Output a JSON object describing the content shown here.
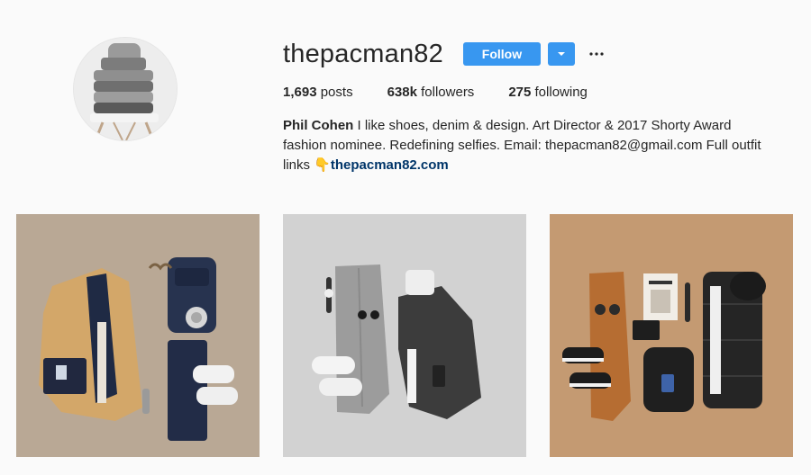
{
  "profile": {
    "username": "thepacman82",
    "follow_label": "Follow",
    "dropdown_icon": "chevron-down-icon",
    "more_icon": "more-options-icon",
    "stats": {
      "posts_count": "1,693",
      "posts_label": "posts",
      "followers_count": "638k",
      "followers_label": "followers",
      "following_count": "275",
      "following_label": "following"
    },
    "bio": {
      "name": "Phil Cohen",
      "text": " I like shoes, denim & design. Art Director & 2017 Shorty Award fashion nominee. Redefining selfies. Email: thepacman82@gmail.com Full outfit links ",
      "emoji": "👇",
      "link": "thepacman82.com"
    }
  },
  "posts": [
    {
      "background": "#b9a895",
      "subject": "camel coat outfit flat lay"
    },
    {
      "background": "#d2d2d2",
      "subject": "grey sweater outfit flat lay"
    },
    {
      "background": "#c49a72",
      "subject": "puffer jacket outfit flat lay"
    }
  ],
  "colors": {
    "accent": "#3897f0",
    "background": "#fafafa",
    "link": "#003569"
  }
}
